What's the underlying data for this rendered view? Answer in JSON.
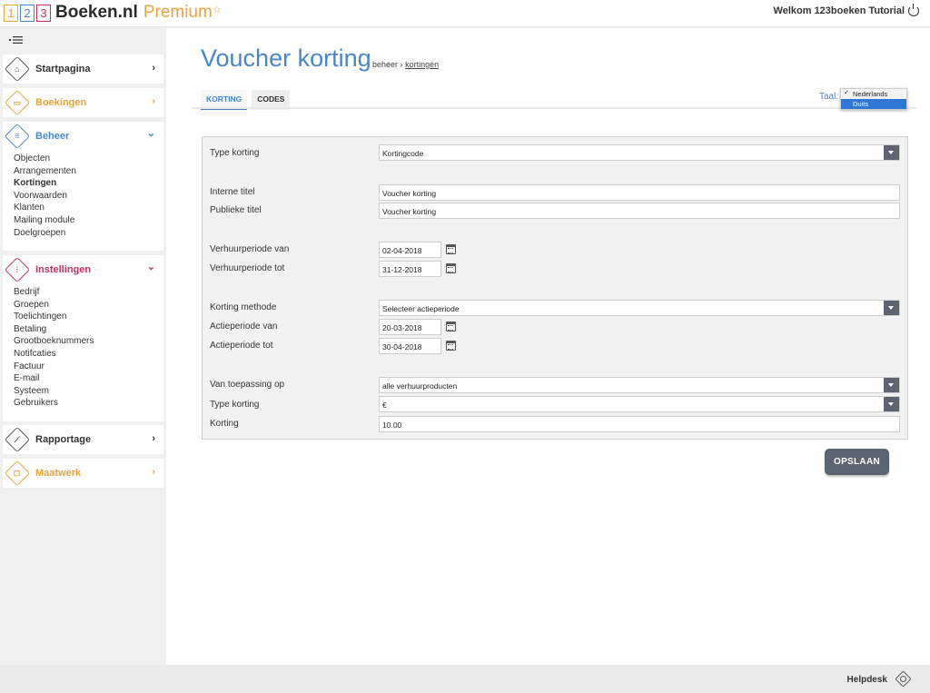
{
  "header": {
    "logo_digits": [
      "1",
      "2",
      "3"
    ],
    "logo_name": "Boeken.nl",
    "logo_premium": "Premium",
    "welcome": "Welkom 123boeken Tutorial"
  },
  "sidebar": {
    "menu_toggle": "•☰",
    "sections": [
      {
        "label": "Startpagina",
        "color": "#333333",
        "icon": "home-icon",
        "arrow": "›"
      },
      {
        "label": "Boekingen",
        "color": "#e8a33c",
        "icon": "calendar-icon",
        "arrow": "›"
      },
      {
        "label": "Beheer",
        "color": "#4a86c5",
        "icon": "list-icon",
        "arrow": "⌄",
        "items": [
          "Objecten",
          "Arrangementen",
          "Kortingen",
          "Voorwaarden",
          "Klanten",
          "Mailing module",
          "Doelgroepen"
        ],
        "active_item": "Kortingen"
      },
      {
        "label": "Instellingen",
        "color": "#c8305f",
        "icon": "sliders-icon",
        "arrow": "⌄",
        "items": [
          "Bedrijf",
          "Groepen",
          "Toelichtingen",
          "Betaling",
          "Grootboeknummers",
          "Notifcaties",
          "Factuur",
          "E-mail",
          "Systeem",
          "Gebruikers"
        ]
      },
      {
        "label": "Rapportage",
        "color": "#333333",
        "icon": "chart-icon",
        "arrow": "›"
      },
      {
        "label": "Maatwerk",
        "color": "#e8a33c",
        "icon": "custom-icon",
        "arrow": "›"
      }
    ]
  },
  "main": {
    "title": "Voucher korting",
    "breadcrumb": {
      "parent": "beheer",
      "separator": "›",
      "current": "kortingen"
    },
    "tabs": [
      {
        "label": "KORTING",
        "active": true
      },
      {
        "label": "CODES",
        "active": false
      }
    ],
    "language": {
      "label": "Taal:",
      "options": [
        {
          "label": "Nederlands",
          "checked": true,
          "highlighted": false
        },
        {
          "label": "Duits",
          "checked": false,
          "highlighted": true
        }
      ]
    },
    "form": {
      "type_korting": {
        "label": "Type korting",
        "value": "Kortingcode"
      },
      "interne_titel": {
        "label": "Interne titel",
        "value": "Voucher korting"
      },
      "publieke_titel": {
        "label": "Publieke titel",
        "value": "Voucher korting"
      },
      "verhuur_van": {
        "label": "Verhuurperiode van",
        "value": "02-04-2018"
      },
      "verhuur_tot": {
        "label": "Verhuurperiode tot",
        "value": "31-12-2018"
      },
      "korting_methode": {
        "label": "Korting methode",
        "value": "Selecteer actieperiode"
      },
      "actie_van": {
        "label": "Actieperiode van",
        "value": "20-03-2018"
      },
      "actie_tot": {
        "label": "Actieperiode tot",
        "value": "30-04-2018"
      },
      "toepassing": {
        "label": "Van toepassing op",
        "value": "alle verhuurproducten"
      },
      "type_korting2": {
        "label": "Type korting",
        "value": "€"
      },
      "korting": {
        "label": "Korting",
        "value": "10.00"
      }
    },
    "save_label": "OPSLAAN"
  },
  "footer": {
    "helpdesk": "Helpdesk"
  },
  "colors": {
    "accent_blue": "#4a86c5",
    "orange": "#e8a33c",
    "magenta": "#c8305f",
    "button_dark": "#5b6470"
  }
}
